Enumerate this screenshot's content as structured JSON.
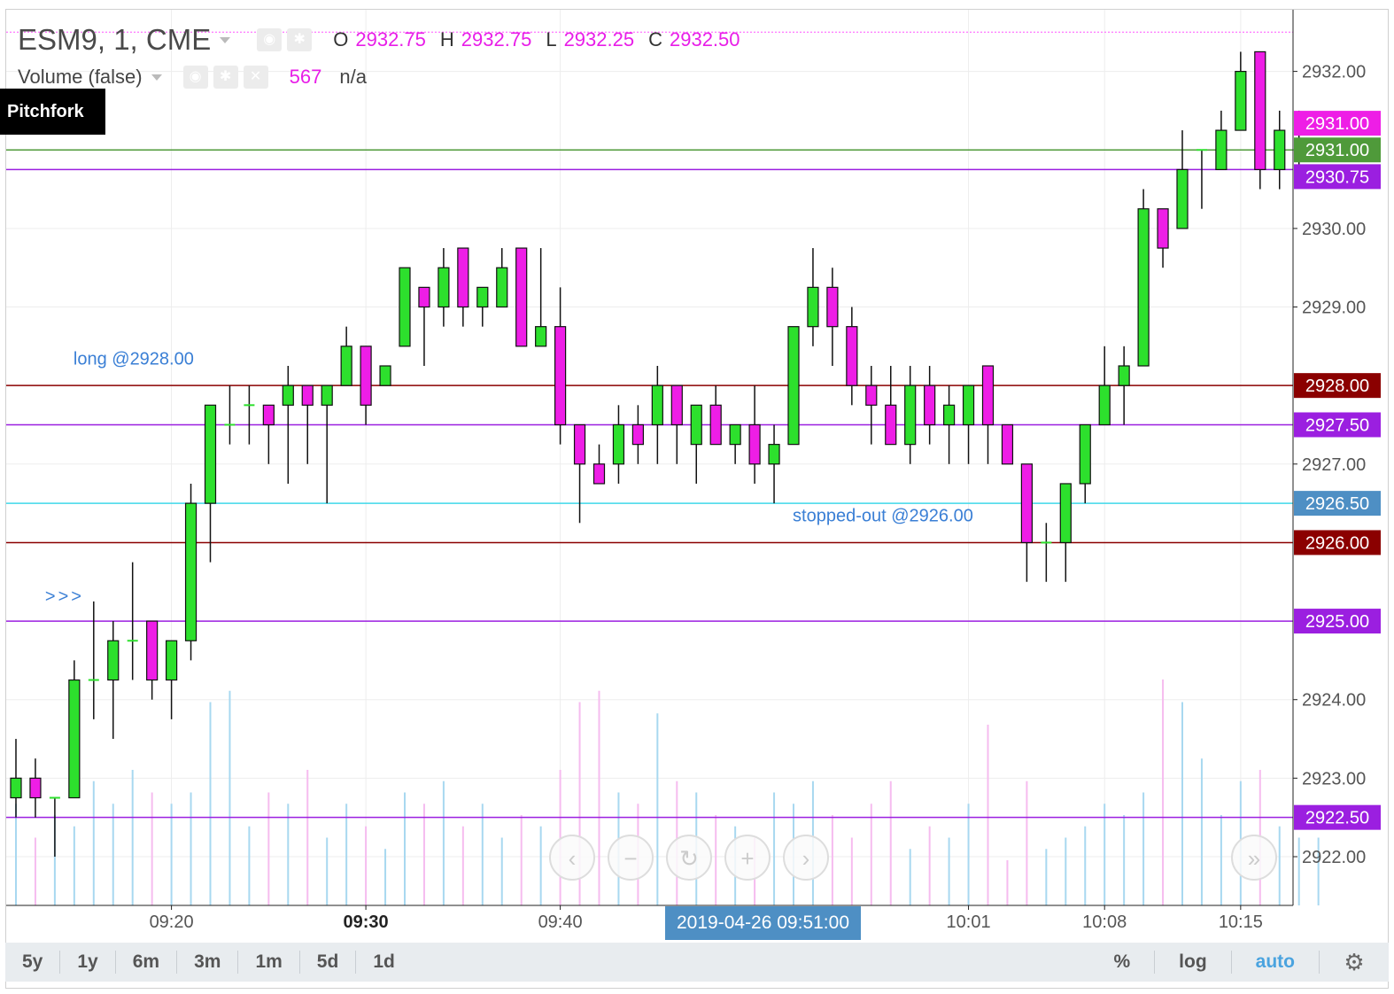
{
  "header": {
    "symbol": "ESM9, 1, CME",
    "ohlc": [
      {
        "key": "O",
        "value": "2932.75"
      },
      {
        "key": "H",
        "value": "2932.75"
      },
      {
        "key": "L",
        "value": "2932.25"
      },
      {
        "key": "C",
        "value": "2932.50"
      }
    ],
    "volume_title": "Volume (false)",
    "volume_value": "567",
    "volume_na": "n/a"
  },
  "pitchfork_label": "Pitchfork",
  "crosshair_date": "2019-04-26 09:51:00",
  "nav_buttons": [
    "‹",
    "−",
    "↻",
    "+",
    "›"
  ],
  "nav_next": "»",
  "timeframes": [
    "5y",
    "1y",
    "6m",
    "3m",
    "1m",
    "5d",
    "1d"
  ],
  "toolbar_right": [
    "%",
    "log",
    "auto"
  ],
  "colors": {
    "up": "#2de02d",
    "down": "#ee1ee6",
    "vol_up": "#a8d8f0",
    "vol_down": "#f6bcef",
    "purple_line": "#9b1fe0",
    "darkred_line": "#8b0000",
    "cyan_line": "#3fd8ea",
    "green_line": "#4f9a3a",
    "magenta_dash": "#ff55ff",
    "annotation_text": "#3a7fd5",
    "accent_blue": "#4e8fc4"
  },
  "chart_data": {
    "type": "candlestick",
    "ylim": [
      2921.5,
      2932.75
    ],
    "y_ticks": [
      "2922.00",
      "2923.00",
      "2924.00",
      "2927.00",
      "2929.00",
      "2930.00",
      "2932.00"
    ],
    "x_ticks": [
      {
        "label": "09:20",
        "bar": 8,
        "bold": false
      },
      {
        "label": "09:30",
        "bar": 18,
        "bold": true
      },
      {
        "label": "09:40",
        "bar": 28,
        "bold": false
      },
      {
        "label": "10:01",
        "bar": 49,
        "bold": false
      },
      {
        "label": "10:08",
        "bar": 56,
        "bold": false
      },
      {
        "label": "10:15",
        "bar": 63,
        "bold": false
      }
    ],
    "candles": [
      {
        "o": 2922.75,
        "h": 2923.5,
        "l": 2922.5,
        "c": 2923.0
      },
      {
        "o": 2923.0,
        "h": 2923.25,
        "l": 2922.5,
        "c": 2922.75
      },
      {
        "o": 2922.75,
        "h": 2922.75,
        "l": 2922.0,
        "c": 2922.75
      },
      {
        "o": 2922.75,
        "h": 2924.5,
        "l": 2922.75,
        "c": 2924.25
      },
      {
        "o": 2924.25,
        "h": 2925.25,
        "l": 2923.75,
        "c": 2924.25
      },
      {
        "o": 2924.25,
        "h": 2925.0,
        "l": 2923.5,
        "c": 2924.75
      },
      {
        "o": 2924.75,
        "h": 2925.75,
        "l": 2924.25,
        "c": 2924.75
      },
      {
        "o": 2925.0,
        "h": 2925.0,
        "l": 2924.0,
        "c": 2924.25
      },
      {
        "o": 2924.25,
        "h": 2924.75,
        "l": 2923.75,
        "c": 2924.75
      },
      {
        "o": 2924.75,
        "h": 2926.75,
        "l": 2924.5,
        "c": 2926.5
      },
      {
        "o": 2926.5,
        "h": 2927.75,
        "l": 2925.75,
        "c": 2927.75
      },
      {
        "o": 2927.5,
        "h": 2928.0,
        "l": 2927.25,
        "c": 2927.5
      },
      {
        "o": 2927.75,
        "h": 2928.0,
        "l": 2927.25,
        "c": 2927.75
      },
      {
        "o": 2927.75,
        "h": 2927.75,
        "l": 2927.0,
        "c": 2927.5
      },
      {
        "o": 2927.75,
        "h": 2928.25,
        "l": 2926.75,
        "c": 2928.0
      },
      {
        "o": 2928.0,
        "h": 2928.0,
        "l": 2927.0,
        "c": 2927.75
      },
      {
        "o": 2927.75,
        "h": 2928.0,
        "l": 2926.5,
        "c": 2928.0
      },
      {
        "o": 2928.0,
        "h": 2928.75,
        "l": 2928.0,
        "c": 2928.5
      },
      {
        "o": 2928.5,
        "h": 2928.5,
        "l": 2927.5,
        "c": 2927.75
      },
      {
        "o": 2928.0,
        "h": 2928.25,
        "l": 2928.0,
        "c": 2928.25
      },
      {
        "o": 2928.5,
        "h": 2929.5,
        "l": 2928.5,
        "c": 2929.5
      },
      {
        "o": 2929.25,
        "h": 2929.25,
        "l": 2928.25,
        "c": 2929.0
      },
      {
        "o": 2929.0,
        "h": 2929.75,
        "l": 2928.75,
        "c": 2929.5
      },
      {
        "o": 2929.75,
        "h": 2929.75,
        "l": 2928.75,
        "c": 2929.0
      },
      {
        "o": 2929.0,
        "h": 2929.25,
        "l": 2928.75,
        "c": 2929.25
      },
      {
        "o": 2929.0,
        "h": 2929.75,
        "l": 2929.0,
        "c": 2929.5
      },
      {
        "o": 2929.75,
        "h": 2929.75,
        "l": 2928.5,
        "c": 2928.5
      },
      {
        "o": 2928.5,
        "h": 2929.75,
        "l": 2928.5,
        "c": 2928.75
      },
      {
        "o": 2928.75,
        "h": 2929.25,
        "l": 2927.25,
        "c": 2927.5
      },
      {
        "o": 2927.5,
        "h": 2927.5,
        "l": 2926.25,
        "c": 2927.0
      },
      {
        "o": 2927.0,
        "h": 2927.25,
        "l": 2926.75,
        "c": 2926.75
      },
      {
        "o": 2927.0,
        "h": 2927.75,
        "l": 2926.75,
        "c": 2927.5
      },
      {
        "o": 2927.5,
        "h": 2927.75,
        "l": 2927.0,
        "c": 2927.25
      },
      {
        "o": 2927.5,
        "h": 2928.25,
        "l": 2927.0,
        "c": 2928.0
      },
      {
        "o": 2928.0,
        "h": 2928.0,
        "l": 2927.0,
        "c": 2927.5
      },
      {
        "o": 2927.25,
        "h": 2927.75,
        "l": 2926.75,
        "c": 2927.75
      },
      {
        "o": 2927.75,
        "h": 2928.0,
        "l": 2927.25,
        "c": 2927.25
      },
      {
        "o": 2927.25,
        "h": 2927.5,
        "l": 2927.0,
        "c": 2927.5
      },
      {
        "o": 2927.5,
        "h": 2928.0,
        "l": 2926.75,
        "c": 2927.0
      },
      {
        "o": 2927.0,
        "h": 2927.5,
        "l": 2926.5,
        "c": 2927.25
      },
      {
        "o": 2927.25,
        "h": 2928.75,
        "l": 2927.25,
        "c": 2928.75
      },
      {
        "o": 2928.75,
        "h": 2929.75,
        "l": 2928.5,
        "c": 2929.25
      },
      {
        "o": 2929.25,
        "h": 2929.5,
        "l": 2928.25,
        "c": 2928.75
      },
      {
        "o": 2928.75,
        "h": 2929.0,
        "l": 2927.75,
        "c": 2928.0
      },
      {
        "o": 2928.0,
        "h": 2928.25,
        "l": 2927.25,
        "c": 2927.75
      },
      {
        "o": 2927.75,
        "h": 2928.25,
        "l": 2927.25,
        "c": 2927.25
      },
      {
        "o": 2927.25,
        "h": 2928.25,
        "l": 2927.0,
        "c": 2928.0
      },
      {
        "o": 2928.0,
        "h": 2928.25,
        "l": 2927.25,
        "c": 2927.5
      },
      {
        "o": 2927.5,
        "h": 2928.0,
        "l": 2927.0,
        "c": 2927.75
      },
      {
        "o": 2927.5,
        "h": 2928.0,
        "l": 2927.0,
        "c": 2928.0
      },
      {
        "o": 2928.25,
        "h": 2928.25,
        "l": 2927.0,
        "c": 2927.5
      },
      {
        "o": 2927.5,
        "h": 2927.5,
        "l": 2927.0,
        "c": 2927.0
      },
      {
        "o": 2927.0,
        "h": 2927.0,
        "l": 2925.5,
        "c": 2926.0
      },
      {
        "o": 2926.0,
        "h": 2926.25,
        "l": 2925.5,
        "c": 2926.0
      },
      {
        "o": 2926.0,
        "h": 2926.75,
        "l": 2925.5,
        "c": 2926.75
      },
      {
        "o": 2926.75,
        "h": 2927.5,
        "l": 2926.5,
        "c": 2927.5
      },
      {
        "o": 2927.5,
        "h": 2928.5,
        "l": 2927.5,
        "c": 2928.0
      },
      {
        "o": 2928.0,
        "h": 2928.5,
        "l": 2927.5,
        "c": 2928.25
      },
      {
        "o": 2928.25,
        "h": 2930.5,
        "l": 2928.25,
        "c": 2930.25
      },
      {
        "o": 2930.25,
        "h": 2930.25,
        "l": 2929.5,
        "c": 2929.75
      },
      {
        "o": 2930.0,
        "h": 2931.25,
        "l": 2930.0,
        "c": 2930.75
      },
      {
        "o": 2931.0,
        "h": 2931.0,
        "l": 2930.25,
        "c": 2931.0
      },
      {
        "o": 2930.75,
        "h": 2931.5,
        "l": 2930.75,
        "c": 2931.25
      },
      {
        "o": 2931.25,
        "h": 2932.25,
        "l": 2931.25,
        "c": 2932.0
      },
      {
        "o": 2932.25,
        "h": 2932.25,
        "l": 2930.5,
        "c": 2930.75
      },
      {
        "o": 2930.75,
        "h": 2931.5,
        "l": 2930.5,
        "c": 2931.25
      },
      {
        "o": 2931.0,
        "h": 2931.5,
        "l": 2930.75,
        "c": 2931.0
      }
    ],
    "volume_relative": [
      0.45,
      0.3,
      0.4,
      0.35,
      0.55,
      0.45,
      0.6,
      0.5,
      0.45,
      0.5,
      0.9,
      0.95,
      0.35,
      0.5,
      0.45,
      0.6,
      0.3,
      0.45,
      0.35,
      0.25,
      0.5,
      0.45,
      0.55,
      0.35,
      0.45,
      0.3,
      0.4,
      0.35,
      0.6,
      0.9,
      0.95,
      0.5,
      0.45,
      0.85,
      0.55,
      0.5,
      0.4,
      0.35,
      0.3,
      0.5,
      0.45,
      0.55,
      0.4,
      0.3,
      0.45,
      0.55,
      0.25,
      0.35,
      0.3,
      0.45,
      0.8,
      0.2,
      0.55,
      0.25,
      0.3,
      0.35,
      0.45,
      0.4,
      0.5,
      1.0,
      0.9,
      0.65,
      0.4,
      0.55,
      0.6,
      0.35,
      0.3,
      0.3
    ],
    "horizontal_lines": [
      {
        "value": 2932.5,
        "color": "#ff55ff",
        "style": "dashed"
      },
      {
        "value": 2931.0,
        "color": "#4f9a3a",
        "style": "solid"
      },
      {
        "value": 2930.75,
        "color": "#9b1fe0",
        "style": "solid"
      },
      {
        "value": 2928.0,
        "color": "#8b0000",
        "style": "solid"
      },
      {
        "value": 2927.5,
        "color": "#9b1fe0",
        "style": "solid"
      },
      {
        "value": 2926.5,
        "color": "#3fd8ea",
        "style": "solid"
      },
      {
        "value": 2926.0,
        "color": "#8b0000",
        "style": "solid"
      },
      {
        "value": 2925.0,
        "color": "#9b1fe0",
        "style": "solid"
      },
      {
        "value": 2922.5,
        "color": "#9b1fe0",
        "style": "solid"
      }
    ],
    "price_badges": [
      {
        "value": 2931.0,
        "y_value": 2931.34,
        "label": "2931.00",
        "color": "#ee1ee6"
      },
      {
        "value": 2931.0,
        "y_value": 2931.0,
        "label": "2931.00",
        "color": "#4f9a3a"
      },
      {
        "value": 2930.75,
        "y_value": 2930.66,
        "label": "2930.75",
        "color": "#9b1fe0"
      },
      {
        "value": 2928.0,
        "y_value": 2928.0,
        "label": "2928.00",
        "color": "#8b0000"
      },
      {
        "value": 2927.5,
        "y_value": 2927.5,
        "label": "2927.50",
        "color": "#9b1fe0"
      },
      {
        "value": 2926.5,
        "y_value": 2926.5,
        "label": "2926.50",
        "color": "#4e8fc4"
      },
      {
        "value": 2926.0,
        "y_value": 2926.0,
        "label": "2926.00",
        "color": "#8b0000"
      },
      {
        "value": 2925.0,
        "y_value": 2925.0,
        "label": "2925.00",
        "color": "#9b1fe0"
      },
      {
        "value": 2922.5,
        "y_value": 2922.5,
        "label": "2922.50",
        "color": "#9b1fe0"
      }
    ],
    "annotations": [
      {
        "text": "long @2928.00",
        "bar": 2,
        "value": 2928.2
      },
      {
        "text": "stopped-out @2926.00",
        "bar": 39,
        "value": 2926.2
      },
      {
        "text": ">>>",
        "bar": 1.5,
        "value": 2925.2
      }
    ]
  }
}
